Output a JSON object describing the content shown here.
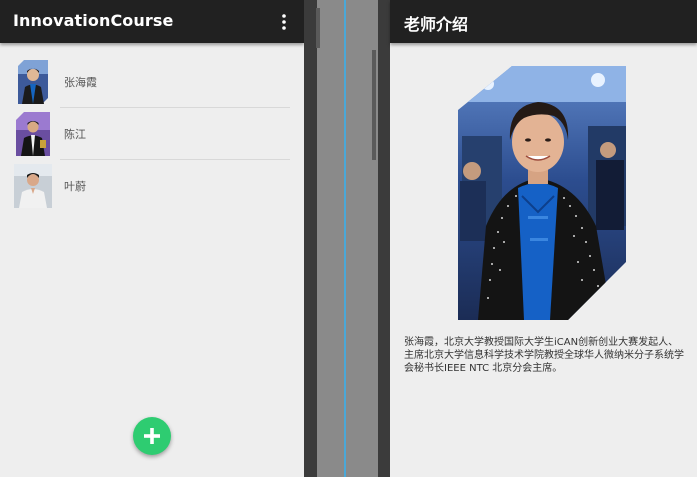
{
  "left_screen": {
    "app_title": "InnovationCourse",
    "menu_icon": "more-vertical-icon",
    "teachers": [
      {
        "name": "张海霞",
        "avatar_icon": "teacher-photo"
      },
      {
        "name": "陈江",
        "avatar_icon": "teacher-photo"
      },
      {
        "name": "叶蔚",
        "avatar_icon": "teacher-photo"
      }
    ],
    "fab_icon": "add-icon",
    "fab_color": "#2ecc71"
  },
  "right_screen": {
    "title": "老师介绍",
    "portrait_icon": "teacher-portrait",
    "bio": "张海霞，北京大学教授国际大学生iCAN创新创业大赛发起人、主席北京大学信息科学技术学院教授全球华人微纳米分子系统学会秘书长IEEE NTC 北京分会主席。"
  },
  "colors": {
    "app_bar": "#212121",
    "background": "#eeeeee",
    "split_line": "#4aa8d8"
  }
}
